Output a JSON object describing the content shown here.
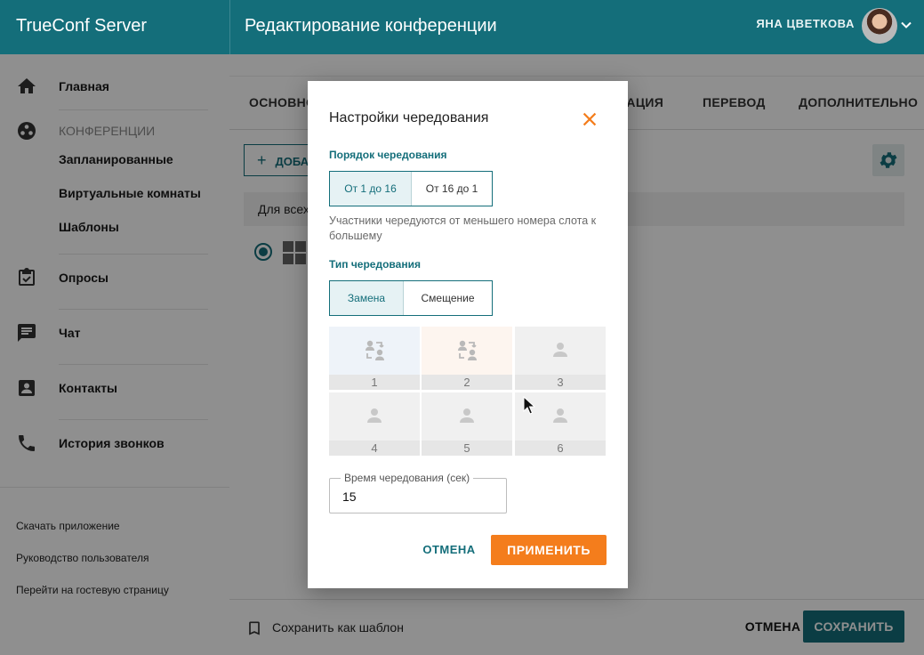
{
  "app": {
    "brand": "TrueConf Server",
    "page_title": "Редактирование конференции",
    "user_name": "ЯНА ЦВЕТКОВА"
  },
  "sidebar": {
    "home": "Главная",
    "conferences": "КОНФЕРЕНЦИИ",
    "conf_items": [
      "Запланированные",
      "Виртуальные комнаты",
      "Шаблоны"
    ],
    "polls": "Опросы",
    "chat": "Чат",
    "contacts": "Контакты",
    "call_history": "История звонков",
    "links": [
      "Скачать приложение",
      "Руководство пользователя",
      "Перейти на гостевую страницу"
    ]
  },
  "main": {
    "tabs": [
      "ОСНОВНО",
      "РАЦИЯ",
      "ПЕРЕВОД",
      "ДОПОЛНИТЕЛЬНО"
    ],
    "add_label": "ДОБА",
    "list_header": "Для всех",
    "save_template": "Сохранить как шаблон",
    "cancel": "ОТМЕНА",
    "save": "СОХРАНИТЬ"
  },
  "dialog": {
    "title": "Настройки чередования",
    "order_label": "Порядок чередования",
    "order_options": [
      "От 1 до 16",
      "От 16 до 1"
    ],
    "order_selected": "От 1 до 16",
    "order_description": "Участники чередуются от меньшего номера слота к большему",
    "type_label": "Тип чередования",
    "type_options": [
      "Замена",
      "Смещение"
    ],
    "type_selected": "Замена",
    "slots": [
      "1",
      "2",
      "3",
      "4",
      "5",
      "6"
    ],
    "interval_label": "Время чередования (сек)",
    "interval_value": "15",
    "cancel": "ОТМЕНА",
    "apply": "ПРИМЕНИТЬ"
  },
  "colors": {
    "accent": "#146e7a",
    "apply": "#f47d1c",
    "close_icon": "#f47d1c"
  }
}
